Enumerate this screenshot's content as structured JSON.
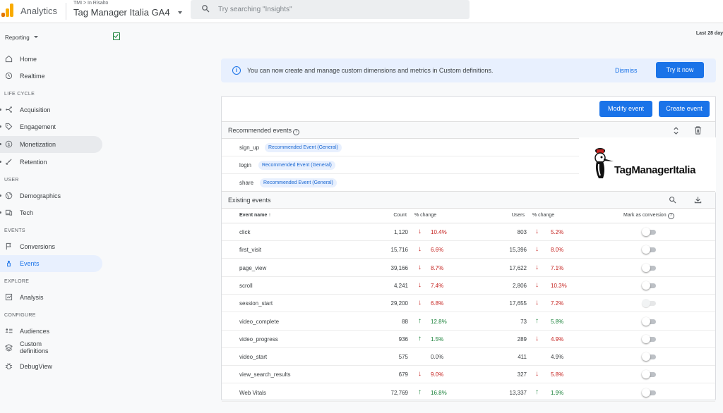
{
  "header": {
    "app_name": "Analytics",
    "breadcrumb": "TMI > In Risalto",
    "property_name": "Tag Manager Italia GA4",
    "search_placeholder": "Try searching \"Insights\""
  },
  "sidebar": {
    "reporting_label": "Reporting",
    "items_top": [
      {
        "label": "Home",
        "icon": "home-icon"
      },
      {
        "label": "Realtime",
        "icon": "clock-icon"
      }
    ],
    "sections": {
      "life_cycle": "LIFE CYCLE",
      "user": "USER",
      "events": "EVENTS",
      "explore": "EXPLORE",
      "configure": "CONFIGURE"
    },
    "life_cycle_items": [
      {
        "label": "Acquisition",
        "icon": "acquisition-icon"
      },
      {
        "label": "Engagement",
        "icon": "tag-icon"
      },
      {
        "label": "Monetization",
        "icon": "dollar-icon"
      },
      {
        "label": "Retention",
        "icon": "retention-icon"
      }
    ],
    "user_items": [
      {
        "label": "Demographics",
        "icon": "globe-icon"
      },
      {
        "label": "Tech",
        "icon": "devices-icon"
      }
    ],
    "events_items": [
      {
        "label": "Conversions",
        "icon": "flag-icon"
      },
      {
        "label": "Events",
        "icon": "touch-icon"
      }
    ],
    "explore_items": [
      {
        "label": "Analysis",
        "icon": "analysis-icon"
      }
    ],
    "configure_items": [
      {
        "label": "Audiences",
        "icon": "audiences-icon"
      },
      {
        "label": "Custom definitions",
        "icon": "custom-definitions-icon"
      },
      {
        "label": "DebugView",
        "icon": "debug-icon"
      }
    ]
  },
  "main": {
    "date_range": "Last 28 day",
    "banner": {
      "message": "You can now create and manage custom dimensions and metrics in Custom definitions.",
      "dismiss": "Dismiss",
      "try_now": "Try it now"
    },
    "buttons": {
      "modify_event": "Modify event",
      "create_event": "Create event"
    },
    "recommended": {
      "title": "Recommended events",
      "rows": [
        {
          "name": "sign_up",
          "chip": "Recommended Event (General)"
        },
        {
          "name": "login",
          "chip": "Recommended Event (General)"
        },
        {
          "name": "share",
          "chip": "Recommended Event (General)"
        }
      ]
    },
    "logo_text": "TagManagerItalia",
    "existing": {
      "title": "Existing events",
      "columns": {
        "event_name": "Event name",
        "count": "Count",
        "count_change": "% change",
        "users": "Users",
        "users_change": "% change",
        "mark_conversion": "Mark as conversion"
      },
      "rows": [
        {
          "name": "click",
          "count": "1,120",
          "count_dir": "down",
          "count_pct": "10.4%",
          "users": "803",
          "users_dir": "down",
          "users_pct": "5.2%",
          "conversion": false,
          "toggle_disabled": false
        },
        {
          "name": "first_visit",
          "count": "15,716",
          "count_dir": "down",
          "count_pct": "6.6%",
          "users": "15,396",
          "users_dir": "down",
          "users_pct": "8.0%",
          "conversion": false,
          "toggle_disabled": false
        },
        {
          "name": "page_view",
          "count": "39,166",
          "count_dir": "down",
          "count_pct": "8.7%",
          "users": "17,622",
          "users_dir": "down",
          "users_pct": "7.1%",
          "conversion": false,
          "toggle_disabled": false
        },
        {
          "name": "scroll",
          "count": "4,241",
          "count_dir": "down",
          "count_pct": "7.4%",
          "users": "2,806",
          "users_dir": "down",
          "users_pct": "10.3%",
          "conversion": false,
          "toggle_disabled": false
        },
        {
          "name": "session_start",
          "count": "29,200",
          "count_dir": "down",
          "count_pct": "6.8%",
          "users": "17,655",
          "users_dir": "down",
          "users_pct": "7.2%",
          "conversion": false,
          "toggle_disabled": true
        },
        {
          "name": "video_complete",
          "count": "88",
          "count_dir": "up",
          "count_pct": "12.8%",
          "users": "73",
          "users_dir": "up",
          "users_pct": "5.8%",
          "conversion": false,
          "toggle_disabled": false
        },
        {
          "name": "video_progress",
          "count": "936",
          "count_dir": "up",
          "count_pct": "1.5%",
          "users": "289",
          "users_dir": "down",
          "users_pct": "4.9%",
          "conversion": false,
          "toggle_disabled": false
        },
        {
          "name": "video_start",
          "count": "575",
          "count_dir": "none",
          "count_pct": "0.0%",
          "users": "411",
          "users_dir": "none",
          "users_pct": "4.9%",
          "conversion": false,
          "toggle_disabled": false
        },
        {
          "name": "view_search_results",
          "count": "679",
          "count_dir": "down",
          "count_pct": "9.0%",
          "users": "327",
          "users_dir": "down",
          "users_pct": "5.8%",
          "conversion": false,
          "toggle_disabled": false
        },
        {
          "name": "Web Vitals",
          "count": "72,769",
          "count_dir": "up",
          "count_pct": "16.8%",
          "users": "13,337",
          "users_dir": "up",
          "users_pct": "1.9%",
          "conversion": false,
          "toggle_disabled": false
        }
      ]
    }
  },
  "colors": {
    "accent": "#1a73e8",
    "down": "#c5221f",
    "up": "#188038",
    "banner_bg": "#e8f0fe",
    "analytics_orange": "#f9ab00"
  }
}
